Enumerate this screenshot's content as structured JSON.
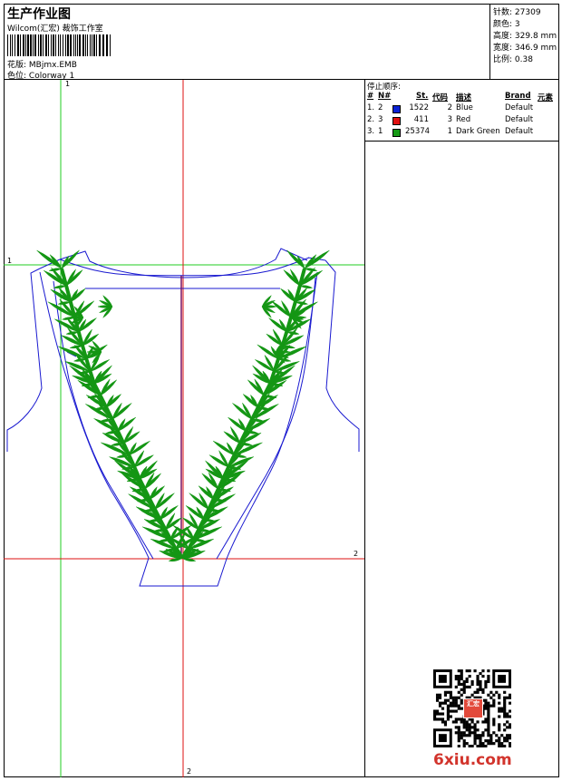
{
  "header": {
    "title": "生产作业图",
    "company": "Wilcom(汇宏) 裁饰工作室",
    "design_label": "花版:",
    "design_value": "MBjmx.EMB",
    "colorway_label": "色位:",
    "colorway_value": "Colorway 1"
  },
  "stats": [
    {
      "label": "针数:",
      "value": "27309"
    },
    {
      "label": "颜色:",
      "value": "3"
    },
    {
      "label": "高度:",
      "value": "329.8 mm"
    },
    {
      "label": "宽度:",
      "value": "346.9 mm"
    },
    {
      "label": "比例:",
      "value": "0.38"
    }
  ],
  "stop_sequence": {
    "title": "停止顺序:",
    "headers": {
      "index": "#",
      "no": "N#",
      "stitches": "St.",
      "code": "代码",
      "desc": "描述",
      "brand": "Brand",
      "element": "元素"
    },
    "rows": [
      {
        "index": "1.",
        "no": "2",
        "color": "#0a22d6",
        "stitches": "1522",
        "code": "2",
        "desc": "Blue",
        "brand": "Default"
      },
      {
        "index": "2.",
        "no": "3",
        "color": "#e01010",
        "stitches": "411",
        "code": "3",
        "desc": "Red",
        "brand": "Default"
      },
      {
        "index": "3.",
        "no": "1",
        "color": "#169a16",
        "stitches": "25374",
        "code": "1",
        "desc": "Dark Green",
        "brand": "Default"
      }
    ]
  },
  "canvas": {
    "guide_label_green_v": "1",
    "guide_label_green_h": "1",
    "guide_label_red_h": "2",
    "guide_label_red_v": "2",
    "colors": {
      "outline": "#1a1ad0",
      "guide_green": "#22cc22",
      "guide_red": "#dd1111",
      "embroidery": "#149614"
    }
  },
  "watermark": {
    "stamp": "汇宏",
    "site": "6xiu.com"
  }
}
